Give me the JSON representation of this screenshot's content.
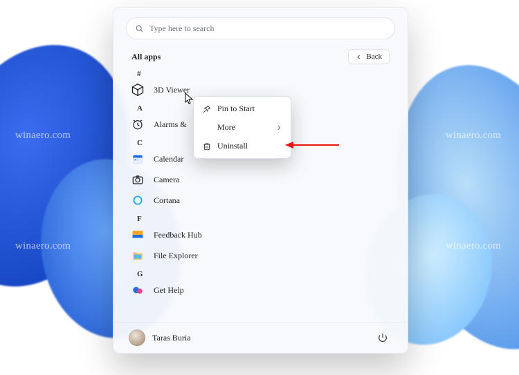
{
  "watermark": "winaero.com",
  "search": {
    "placeholder": "Type here to search"
  },
  "header": {
    "title": "All apps",
    "back_label": "Back"
  },
  "list": [
    {
      "type": "letter",
      "label": "#"
    },
    {
      "type": "app",
      "key": "3dviewer",
      "label": "3D Viewer"
    },
    {
      "type": "letter",
      "label": "A"
    },
    {
      "type": "app",
      "key": "alarms",
      "label": "Alarms &"
    },
    {
      "type": "letter",
      "label": "C"
    },
    {
      "type": "app",
      "key": "calendar",
      "label": "Calendar"
    },
    {
      "type": "app",
      "key": "camera",
      "label": "Camera"
    },
    {
      "type": "app",
      "key": "cortana",
      "label": "Cortana"
    },
    {
      "type": "letter",
      "label": "F"
    },
    {
      "type": "app",
      "key": "feedback",
      "label": "Feedback Hub"
    },
    {
      "type": "app",
      "key": "explorer",
      "label": "File Explorer"
    },
    {
      "type": "letter",
      "label": "G"
    },
    {
      "type": "app",
      "key": "gethelp",
      "label": "Get Help"
    }
  ],
  "context_menu": {
    "pin": "Pin to Start",
    "more": "More",
    "uninstall": "Uninstall"
  },
  "user": {
    "name": "Taras Buria"
  },
  "taskbar": {
    "items": [
      "start",
      "search",
      "taskview",
      "widgets",
      "chat",
      "edge",
      "explorer"
    ]
  }
}
